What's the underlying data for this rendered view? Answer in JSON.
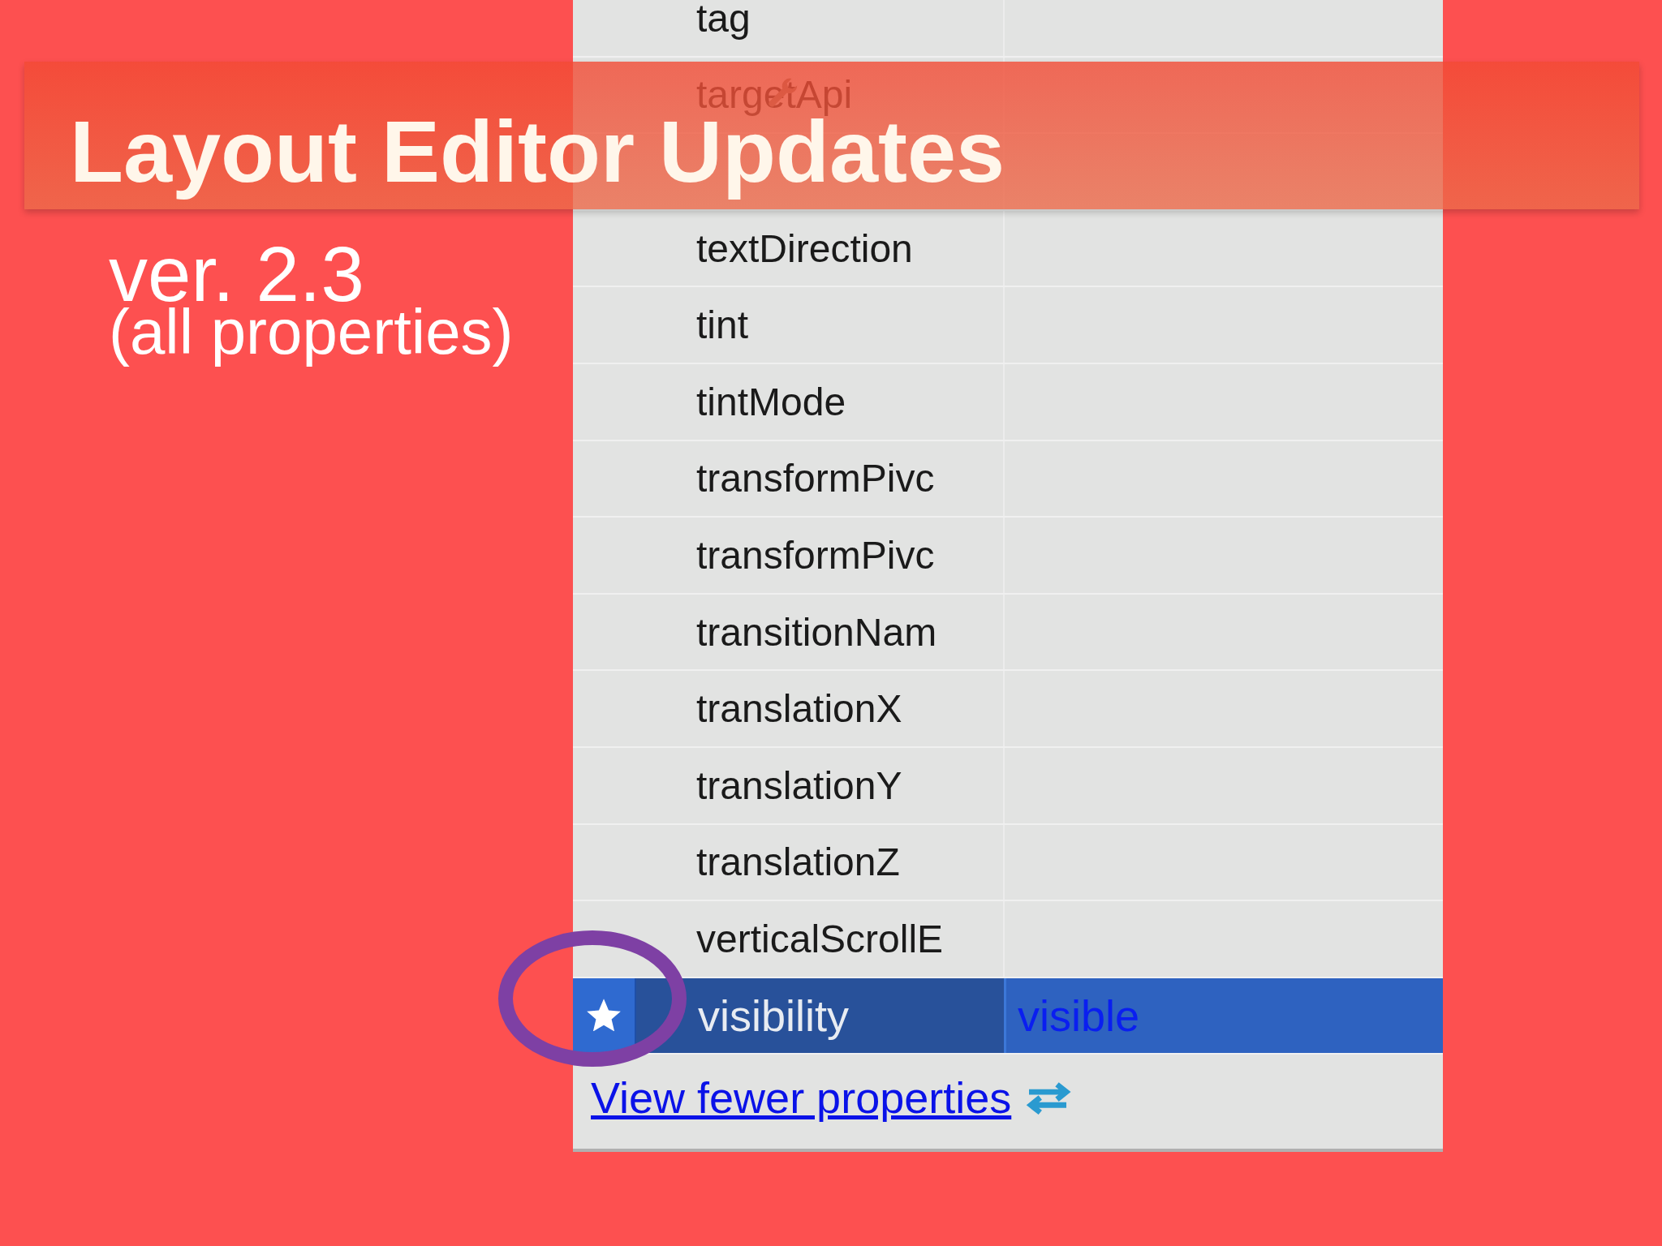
{
  "slide": {
    "title": "Layout Editor Updates",
    "subtitle": "ver. 2.3",
    "note": "(all properties)"
  },
  "properties": [
    {
      "name": "tag",
      "kind": "plain",
      "selected": false,
      "starred": false
    },
    {
      "name": "targetApi",
      "kind": "tool",
      "selected": false,
      "starred": false
    },
    {
      "kind": "covered"
    },
    {
      "name": "textDirection",
      "kind": "plain",
      "selected": false,
      "starred": false
    },
    {
      "name": "tint",
      "kind": "plain",
      "selected": false,
      "starred": false
    },
    {
      "name": "tintMode",
      "kind": "plain",
      "selected": false,
      "starred": false
    },
    {
      "name": "transformPivc",
      "kind": "plain",
      "selected": false,
      "starred": false
    },
    {
      "name": "transformPivc",
      "kind": "plain",
      "selected": false,
      "starred": false
    },
    {
      "name": "transitionNam",
      "kind": "plain",
      "selected": false,
      "starred": false
    },
    {
      "name": "translationX",
      "kind": "plain",
      "selected": false,
      "starred": false
    },
    {
      "name": "translationY",
      "kind": "plain",
      "selected": false,
      "starred": false
    },
    {
      "name": "translationZ",
      "kind": "plain",
      "selected": false,
      "starred": false
    },
    {
      "name": "verticalScrollE",
      "kind": "plain",
      "selected": false,
      "starred": false
    },
    {
      "name": "visibility",
      "kind": "plain",
      "selected": true,
      "starred": true,
      "value": "visible"
    }
  ],
  "link": "View fewer properties"
}
